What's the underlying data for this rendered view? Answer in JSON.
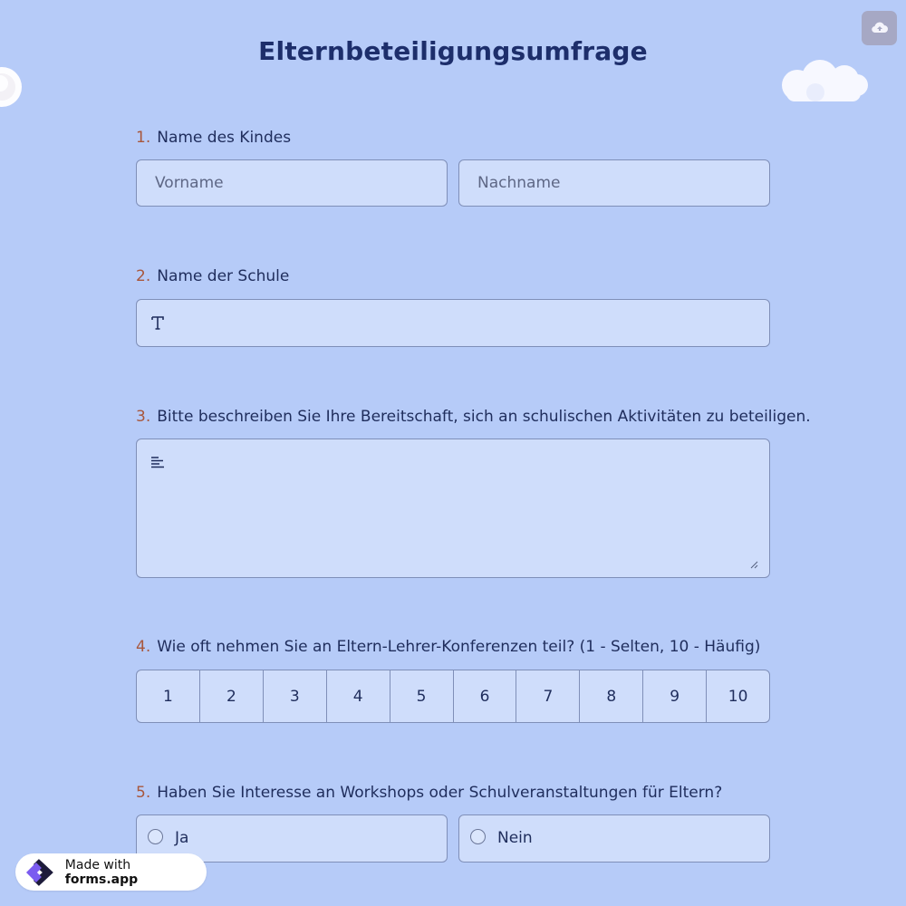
{
  "title": "Elternbeteiligungsumfrage",
  "icons": {
    "save": "cloud-upload-icon",
    "text": "text-icon",
    "paragraph": "align-left-icon",
    "logo": "forms-app-logo-icon"
  },
  "questions": [
    {
      "number": "1.",
      "label": "Name des Kindes",
      "first_placeholder": "Vorname",
      "last_placeholder": "Nachname"
    },
    {
      "number": "2.",
      "label": "Name der Schule",
      "value": ""
    },
    {
      "number": "3.",
      "label": "Bitte beschreiben Sie Ihre Bereitschaft, sich an schulischen Aktivitäten zu beteiligen.",
      "value": ""
    },
    {
      "number": "4.",
      "label": "Wie oft nehmen Sie an Eltern-Lehrer-Konferenzen teil? (1 - Selten, 10 - Häufig)",
      "scale": [
        "1",
        "2",
        "3",
        "4",
        "5",
        "6",
        "7",
        "8",
        "9",
        "10"
      ]
    },
    {
      "number": "5.",
      "label": "Haben Sie Interesse an Workshops oder Schulveranstaltungen für Eltern?",
      "options": [
        "Ja",
        "Nein"
      ]
    }
  ],
  "badge": {
    "prefix": "Made with",
    "brand": "forms.app"
  },
  "colors": {
    "background": "#b6cbf8",
    "field": "#cfddfb",
    "accent_number": "#a8573c",
    "title": "#1d2e6b"
  }
}
